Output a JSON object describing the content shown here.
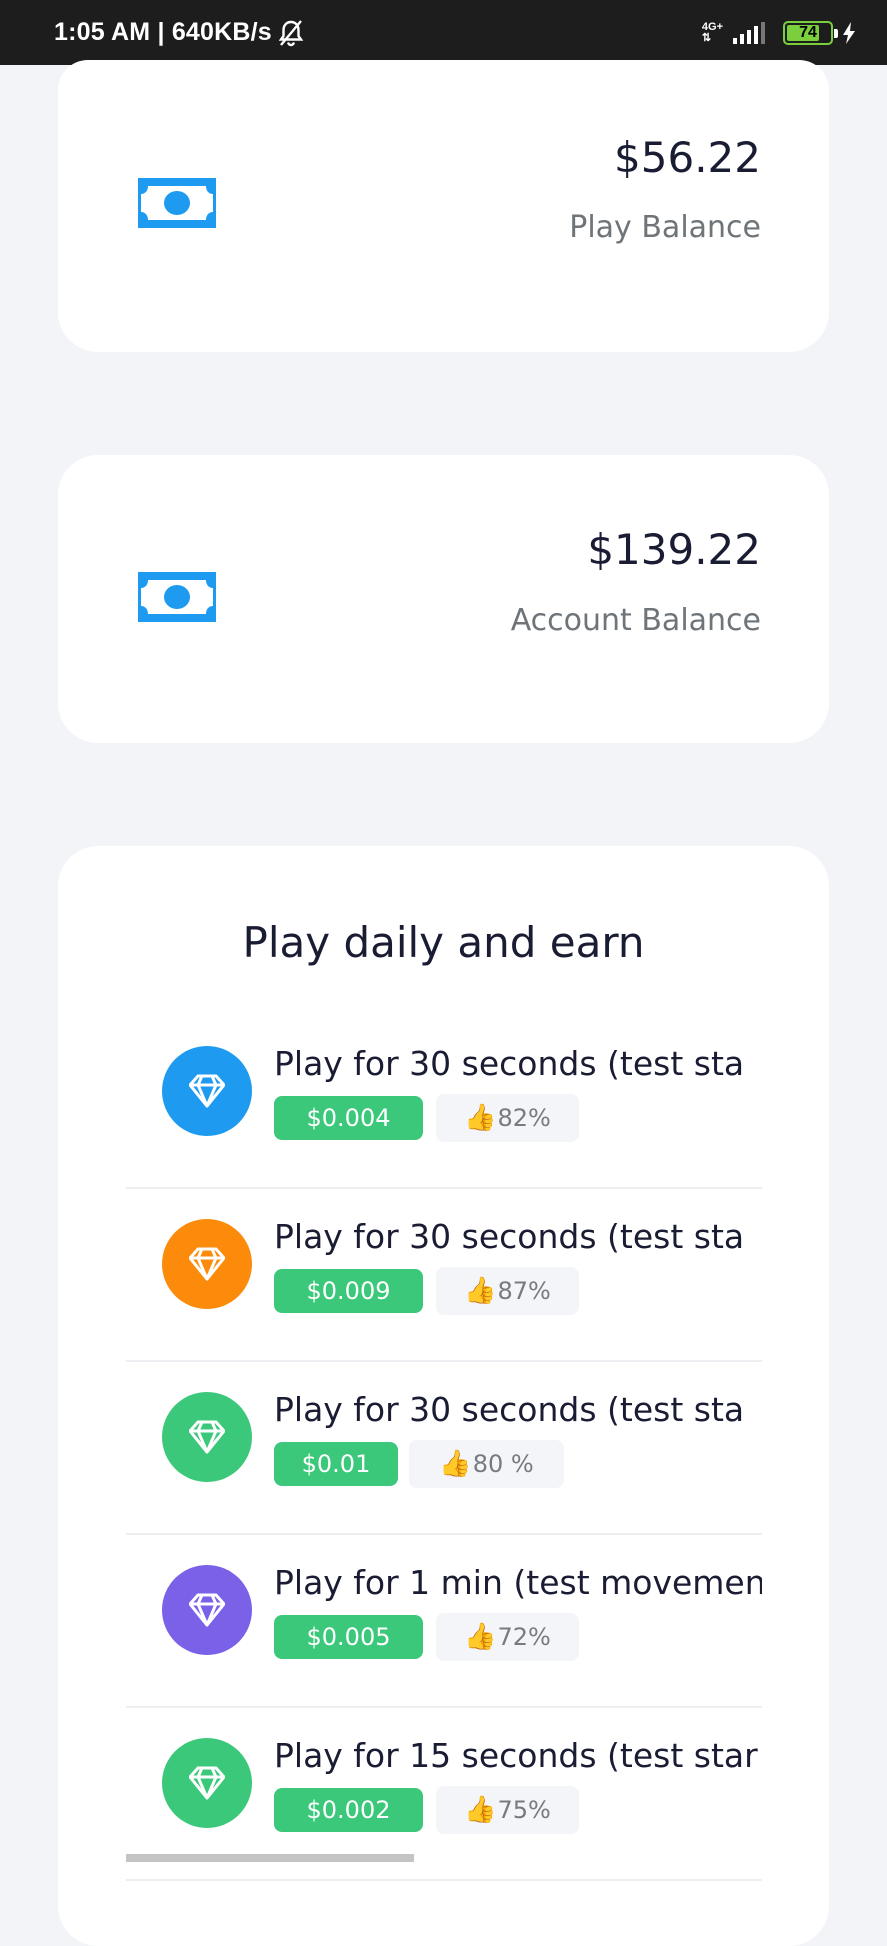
{
  "status_bar": {
    "time_speed": "1:05 AM | 640KB/s",
    "network": "4G+",
    "battery_level": "74"
  },
  "play_balance": {
    "amount": "$56.22",
    "label": "Play Balance",
    "icon": "banknote-icon"
  },
  "account_balance": {
    "amount": "$139.22",
    "label": "Account Balance",
    "icon": "banknote-icon"
  },
  "daily": {
    "title": "Play daily and earn",
    "tasks": [
      {
        "title": "Play for 30 seconds (test sta",
        "reward": "$0.004",
        "rating": "82%",
        "icon_color": "#1e9bf0",
        "icon": "diamond-icon"
      },
      {
        "title": "Play for 30 seconds (test sta",
        "reward": "$0.009",
        "rating": "87%",
        "icon_color": "#fc8b0c",
        "icon": "diamond-icon"
      },
      {
        "title": "Play for 30 seconds (test sta",
        "reward": "$0.01",
        "rating": "80 %",
        "icon_color": "#3cc87a",
        "icon": "diamond-icon"
      },
      {
        "title": "Play for 1 min (test movemen",
        "reward": "$0.005",
        "rating": "72%",
        "icon_color": "#7b61e8",
        "icon": "diamond-icon"
      },
      {
        "title": "Play for 15 seconds (test star",
        "reward": "$0.002",
        "rating": "75%",
        "icon_color": "#3cc87a",
        "icon": "diamond-icon"
      }
    ],
    "scroll_position": 0.45
  },
  "colors": {
    "accent_blue": "#1e9bf0",
    "reward_green": "#3cc87a",
    "background": "#f2f4f8"
  }
}
